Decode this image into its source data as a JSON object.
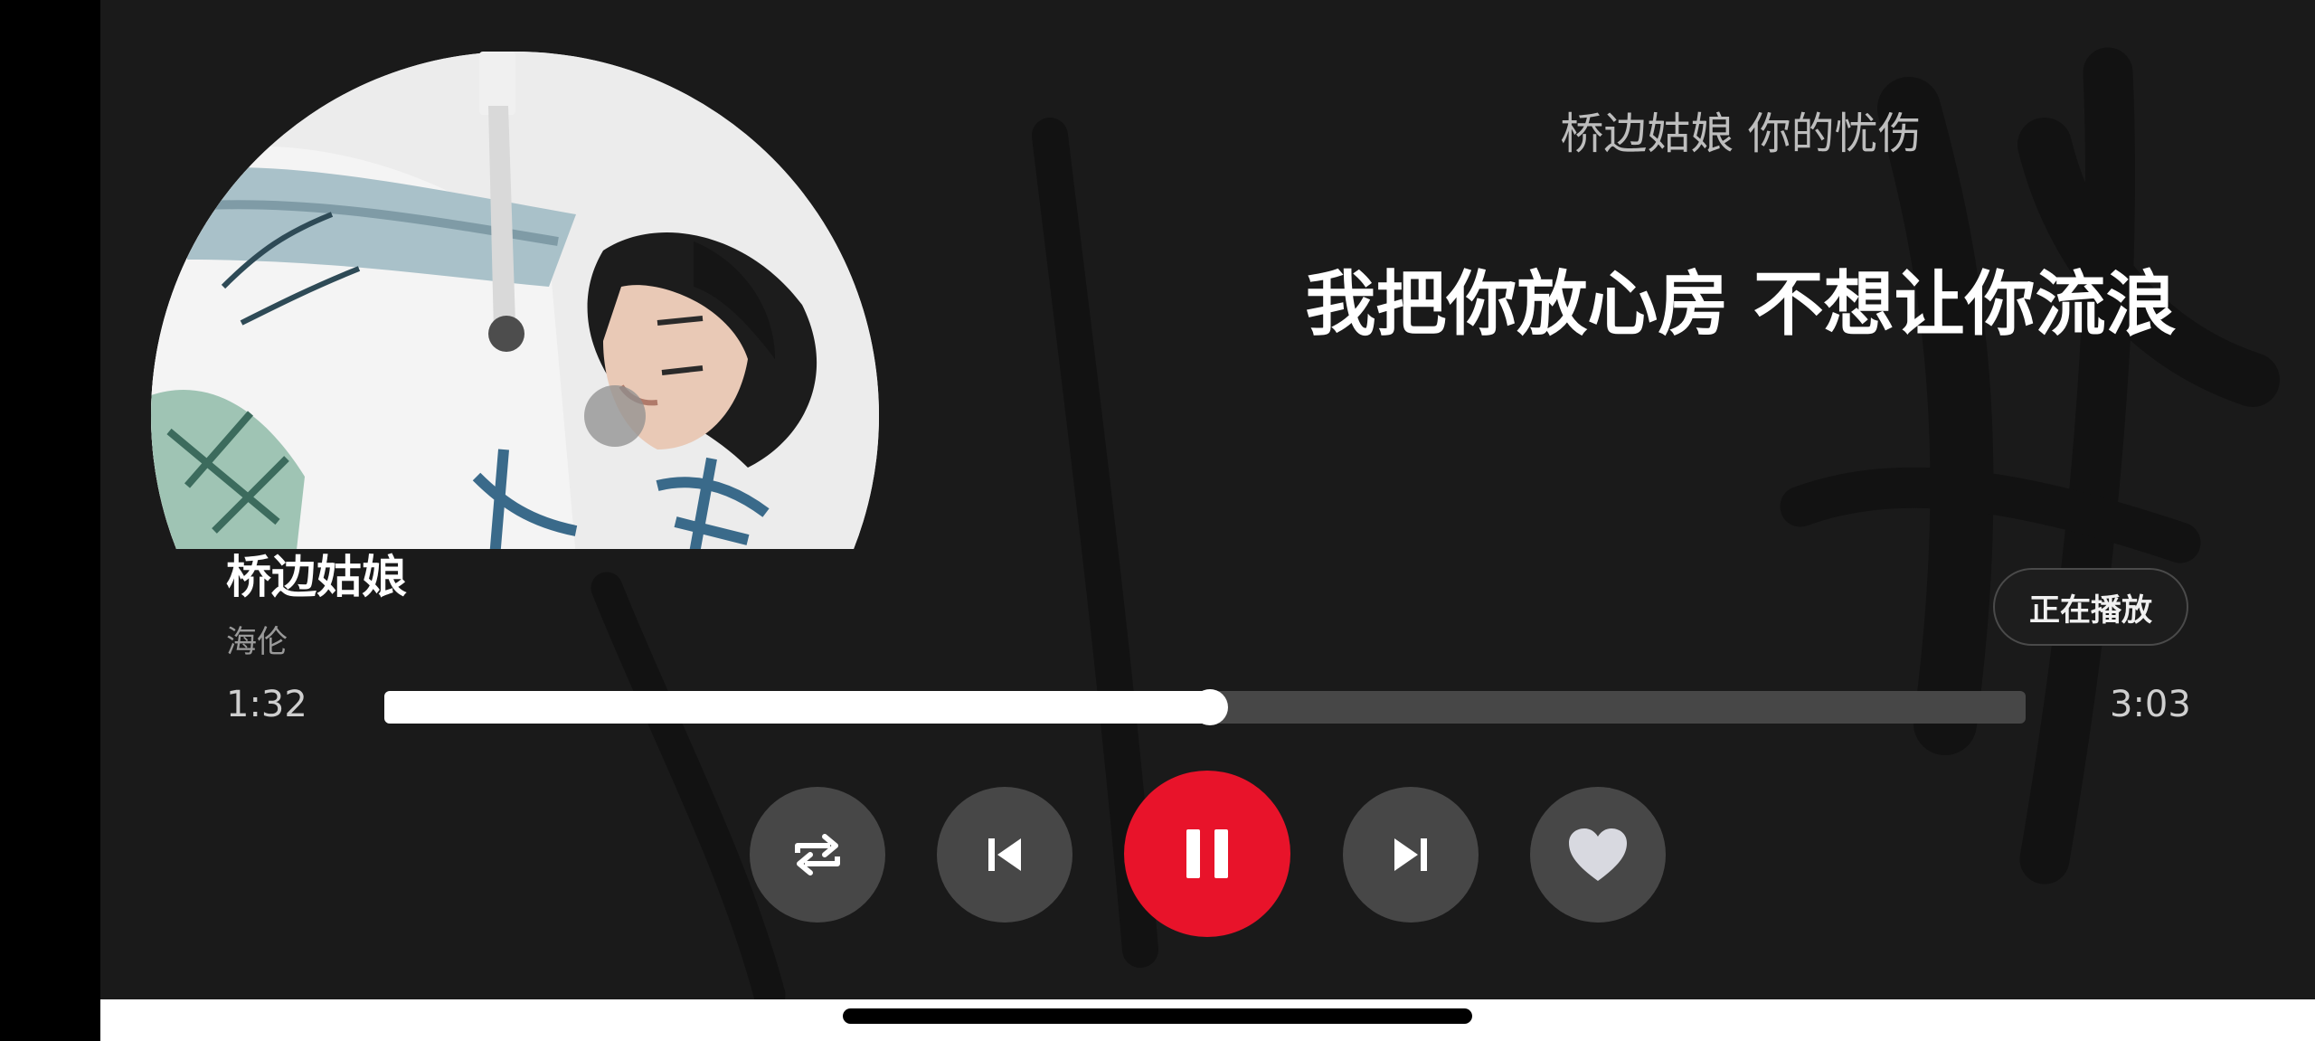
{
  "song": {
    "title": "桥边姑娘",
    "artist": "海伦"
  },
  "lyrics": {
    "previous_line": "桥边姑娘 你的忧伤",
    "current_line": "我把你放心房 不想让你流浪"
  },
  "now_playing_button": {
    "label": "正在播放"
  },
  "progress": {
    "current_time": "1:32",
    "total_time": "3:03",
    "fraction": 0.503
  },
  "controls": {
    "repeat_icon": "repeat-icon",
    "previous_icon": "skip-previous-icon",
    "play_pause_icon": "pause-icon",
    "next_icon": "skip-next-icon",
    "like_icon": "heart-icon"
  },
  "colors": {
    "accent": "#e8132a",
    "background": "#1a1a1a",
    "control_bg": "#474747",
    "progress_track": "#474747",
    "progress_fill": "#ffffff",
    "heart": "#d8d9e0"
  }
}
